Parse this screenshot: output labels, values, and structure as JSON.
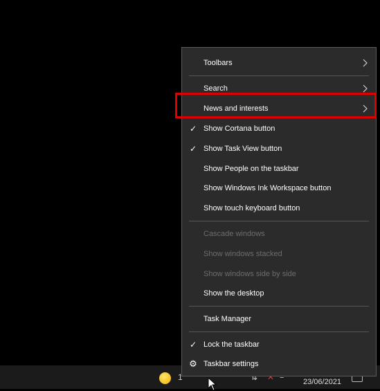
{
  "menu": {
    "items": [
      {
        "label": "Toolbars",
        "submenu": true,
        "checked": false,
        "enabled": true
      },
      {
        "label": "Search",
        "submenu": true,
        "checked": false,
        "enabled": true
      },
      {
        "label": "News and interests",
        "submenu": true,
        "checked": false,
        "enabled": true
      },
      {
        "label": "Show Cortana button",
        "submenu": false,
        "checked": true,
        "enabled": true
      },
      {
        "label": "Show Task View button",
        "submenu": false,
        "checked": true,
        "enabled": true
      },
      {
        "label": "Show People on the taskbar",
        "submenu": false,
        "checked": false,
        "enabled": true
      },
      {
        "label": "Show Windows Ink Workspace button",
        "submenu": false,
        "checked": false,
        "enabled": true
      },
      {
        "label": "Show touch keyboard button",
        "submenu": false,
        "checked": false,
        "enabled": true
      },
      {
        "label": "Cascade windows",
        "submenu": false,
        "checked": false,
        "enabled": false
      },
      {
        "label": "Show windows stacked",
        "submenu": false,
        "checked": false,
        "enabled": false
      },
      {
        "label": "Show windows side by side",
        "submenu": false,
        "checked": false,
        "enabled": false
      },
      {
        "label": "Show the desktop",
        "submenu": false,
        "checked": false,
        "enabled": true
      },
      {
        "label": "Task Manager",
        "submenu": false,
        "checked": false,
        "enabled": true
      },
      {
        "label": "Lock the taskbar",
        "submenu": false,
        "checked": true,
        "enabled": true
      },
      {
        "label": "Taskbar settings",
        "submenu": false,
        "checked": false,
        "enabled": true,
        "icon": "gear-icon"
      }
    ],
    "check_glyph": "✓",
    "gear_glyph": "⚙"
  },
  "taskbar": {
    "weather_temp": "1",
    "date": "23/06/2021"
  },
  "colors": {
    "menu_bg": "#2b2b2b",
    "highlight_border": "#e00000",
    "disabled_text": "#6d6d6d"
  }
}
